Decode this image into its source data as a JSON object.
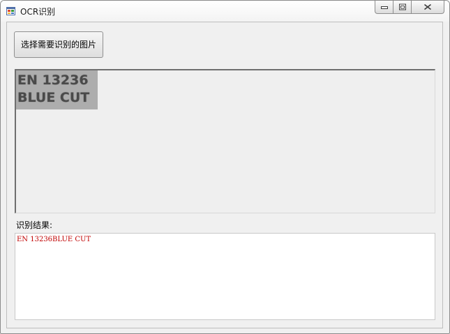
{
  "window": {
    "title": "OCR识别"
  },
  "toolbar": {
    "select_image_label": "选择需要识别的图片"
  },
  "preview": {
    "line1": "EN 13236",
    "line2": "BLUE CUT"
  },
  "result": {
    "label": "识别结果:",
    "text": "EN 13236BLUE CUT"
  },
  "icons": {
    "app": "app-form-icon",
    "minimize": "minimize-icon",
    "maximize": "maximize-icon",
    "close": "close-icon"
  },
  "colors": {
    "result_text": "#c00000",
    "window_bg": "#f0f0f0"
  }
}
